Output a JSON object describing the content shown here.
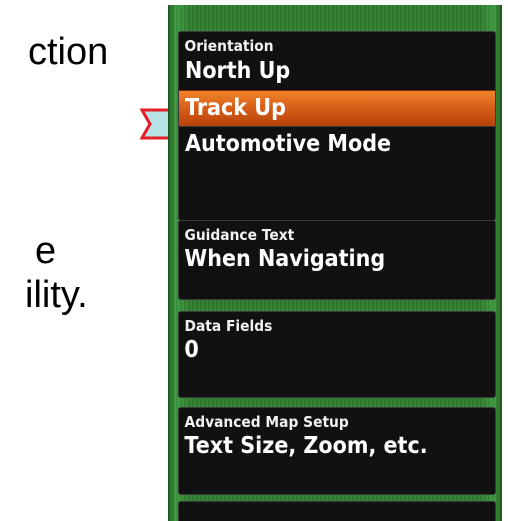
{
  "slide": {
    "line1": "ction",
    "line2": "e",
    "line3": "ility."
  },
  "colors": {
    "arrow_fill": "#b8e3e6",
    "arrow_stroke": "#e21f26",
    "selected_bg": "#d8601a",
    "device_green": "#2f7d2f",
    "panel_bg": "#111111"
  },
  "menu": {
    "orientation": {
      "title": "Orientation",
      "options": [
        "North Up",
        "Track Up",
        "Automotive Mode"
      ],
      "selected": "Track Up"
    },
    "guidance_text": {
      "title": "Guidance Text",
      "value": "When Navigating"
    },
    "data_fields": {
      "title": "Data Fields",
      "value": "0"
    },
    "advanced_map_setup": {
      "title": "Advanced Map Setup",
      "value": "Text Size, Zoom, etc."
    }
  }
}
